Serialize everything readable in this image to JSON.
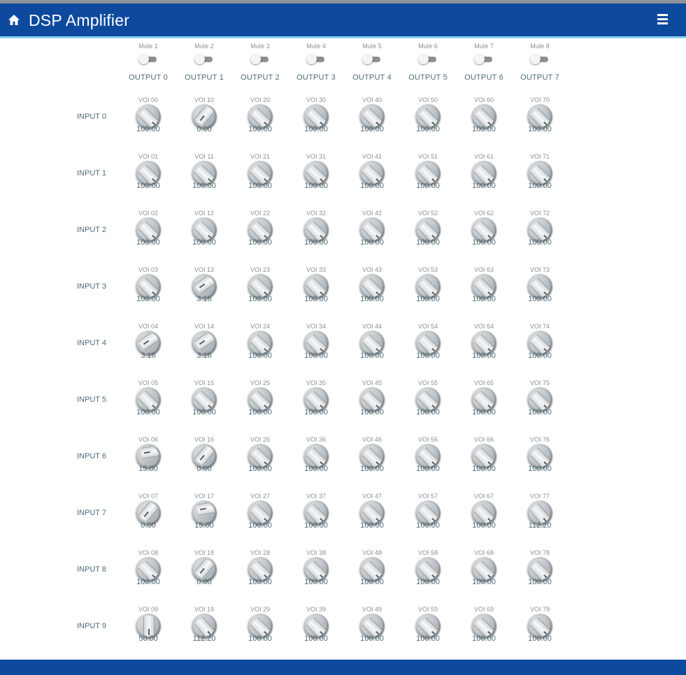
{
  "header": {
    "title": "DSP Amplifier",
    "home_icon": "home-icon",
    "menu_icon": "menu-icon",
    "background_color": "#0d4a9e",
    "accent_color": "#8fd4ee"
  },
  "mutes": [
    "Mute 1",
    "Mute 2",
    "Mute 3",
    "Mute 4",
    "Mute 5",
    "Mute 6",
    "Mute 7",
    "Mute 8"
  ],
  "outputs": [
    "OUTPUT 0",
    "OUTPUT 1",
    "OUTPUT 2",
    "OUTPUT 3",
    "OUTPUT 4",
    "OUTPUT 5",
    "OUTPUT 6",
    "OUTPUT 7"
  ],
  "inputs": [
    {
      "label": "INPUT 0",
      "knobs": [
        {
          "name": "VOI 00",
          "value": "100.00"
        },
        {
          "name": "VOI 10",
          "value": "0.00"
        },
        {
          "name": "VOI 20",
          "value": "100.00"
        },
        {
          "name": "VOI 30",
          "value": "100.00"
        },
        {
          "name": "VOI 40",
          "value": "100.00"
        },
        {
          "name": "VOI 50",
          "value": "100.00"
        },
        {
          "name": "VOI 60",
          "value": "100.00"
        },
        {
          "name": "VOI 70",
          "value": "100.00"
        }
      ]
    },
    {
      "label": "INPUT 1",
      "knobs": [
        {
          "name": "VOI 01",
          "value": "100.00"
        },
        {
          "name": "VOI 11",
          "value": "100.00"
        },
        {
          "name": "VOI 21",
          "value": "100.00"
        },
        {
          "name": "VOI 31",
          "value": "100.00"
        },
        {
          "name": "VOI 41",
          "value": "100.00"
        },
        {
          "name": "VOI 51",
          "value": "100.00"
        },
        {
          "name": "VOI 61",
          "value": "100.00"
        },
        {
          "name": "VOI 71",
          "value": "100.00"
        }
      ]
    },
    {
      "label": "INPUT 2",
      "knobs": [
        {
          "name": "VOI 02",
          "value": "100.00"
        },
        {
          "name": "VOI 12",
          "value": "100.00"
        },
        {
          "name": "VOI 22",
          "value": "100.00"
        },
        {
          "name": "VOI 32",
          "value": "100.00"
        },
        {
          "name": "VOI 42",
          "value": "100.00"
        },
        {
          "name": "VOI 52",
          "value": "100.00"
        },
        {
          "name": "VOI 62",
          "value": "100.00"
        },
        {
          "name": "VOI 72",
          "value": "100.00"
        }
      ]
    },
    {
      "label": "INPUT 3",
      "knobs": [
        {
          "name": "VOI 03",
          "value": "100.00"
        },
        {
          "name": "VOI 13",
          "value": "3.16"
        },
        {
          "name": "VOI 23",
          "value": "100.00"
        },
        {
          "name": "VOI 33",
          "value": "100.00"
        },
        {
          "name": "VOI 43",
          "value": "100.00"
        },
        {
          "name": "VOI 53",
          "value": "100.00"
        },
        {
          "name": "VOI 63",
          "value": "100.00"
        },
        {
          "name": "VOI 73",
          "value": "100.00"
        }
      ]
    },
    {
      "label": "INPUT 4",
      "knobs": [
        {
          "name": "VOI 04",
          "value": "3.16"
        },
        {
          "name": "VOI 14",
          "value": "3.16"
        },
        {
          "name": "VOI 24",
          "value": "100.00"
        },
        {
          "name": "VOI 34",
          "value": "100.00"
        },
        {
          "name": "VOI 44",
          "value": "100.00"
        },
        {
          "name": "VOI 54",
          "value": "100.00"
        },
        {
          "name": "VOI 64",
          "value": "100.00"
        },
        {
          "name": "VOI 74",
          "value": "100.00"
        }
      ]
    },
    {
      "label": "INPUT 5",
      "knobs": [
        {
          "name": "VOI 05",
          "value": "100.00"
        },
        {
          "name": "VOI 15",
          "value": "100.00"
        },
        {
          "name": "VOI 25",
          "value": "100.00"
        },
        {
          "name": "VOI 35",
          "value": "100.00"
        },
        {
          "name": "VOI 45",
          "value": "100.00"
        },
        {
          "name": "VOI 55",
          "value": "100.00"
        },
        {
          "name": "VOI 65",
          "value": "100.00"
        },
        {
          "name": "VOI 75",
          "value": "100.00"
        }
      ]
    },
    {
      "label": "INPUT 6",
      "knobs": [
        {
          "name": "VOI 06",
          "value": "15.00"
        },
        {
          "name": "VOI 16",
          "value": "0.00"
        },
        {
          "name": "VOI 26",
          "value": "100.00"
        },
        {
          "name": "VOI 36",
          "value": "100.00"
        },
        {
          "name": "VOI 46",
          "value": "100.00"
        },
        {
          "name": "VOI 56",
          "value": "100.00"
        },
        {
          "name": "VOI 66",
          "value": "100.00"
        },
        {
          "name": "VOI 76",
          "value": "100.00"
        }
      ]
    },
    {
      "label": "INPUT 7",
      "knobs": [
        {
          "name": "VOI 07",
          "value": "0.00"
        },
        {
          "name": "VOI 17",
          "value": "15.00"
        },
        {
          "name": "VOI 27",
          "value": "100.00"
        },
        {
          "name": "VOI 37",
          "value": "100.00"
        },
        {
          "name": "VOI 47",
          "value": "100.00"
        },
        {
          "name": "VOI 57",
          "value": "100.00"
        },
        {
          "name": "VOI 67",
          "value": "100.00"
        },
        {
          "name": "VOI 77",
          "value": "112.20"
        }
      ]
    },
    {
      "label": "INPUT 8",
      "knobs": [
        {
          "name": "VOI 08",
          "value": "100.00"
        },
        {
          "name": "VOI 18",
          "value": "0.00"
        },
        {
          "name": "VOI 28",
          "value": "100.00"
        },
        {
          "name": "VOI 38",
          "value": "100.00"
        },
        {
          "name": "VOI 48",
          "value": "100.00"
        },
        {
          "name": "VOI 58",
          "value": "100.00"
        },
        {
          "name": "VOI 68",
          "value": "100.00"
        },
        {
          "name": "VOI 78",
          "value": "100.00"
        }
      ]
    },
    {
      "label": "INPUT 9",
      "knobs": [
        {
          "name": "VOI 09",
          "value": "50.00"
        },
        {
          "name": "VOI 19",
          "value": "112.20"
        },
        {
          "name": "VOI 29",
          "value": "100.00"
        },
        {
          "name": "VOI 39",
          "value": "100.00"
        },
        {
          "name": "VOI 49",
          "value": "100.00"
        },
        {
          "name": "VOI 59",
          "value": "100.00"
        },
        {
          "name": "VOI 69",
          "value": "100.00"
        },
        {
          "name": "VOI 79",
          "value": "100.00"
        }
      ]
    }
  ]
}
